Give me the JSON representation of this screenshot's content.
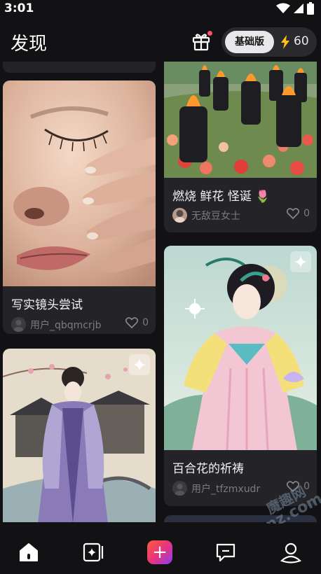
{
  "status_bar": {
    "time": "3:01"
  },
  "header": {
    "title": "发现",
    "plan_label": "基础版",
    "credits": "60"
  },
  "cards": [
    {
      "title": "写实镜头尝试",
      "author": "用户_qbqmcrjb",
      "likes": "0"
    },
    {
      "title": "燃烧 鲜花 怪诞 🌷",
      "author": "无敌豆女士",
      "likes": "0"
    },
    {
      "title": "百合花的祈祷",
      "author": "用户_tfzmxudr",
      "likes": "0"
    },
    {
      "title": "",
      "author": "",
      "likes": ""
    }
  ],
  "bottom_nav": {
    "items": [
      {
        "icon": "home-icon"
      },
      {
        "icon": "gallery-icon"
      },
      {
        "icon": "create-plus-icon",
        "label": "+"
      },
      {
        "icon": "message-icon"
      },
      {
        "icon": "profile-icon"
      }
    ]
  },
  "watermark": {
    "cn": "魔趣网",
    "en": "mfunz.com"
  },
  "colors": {
    "accent_gradient": [
      "#ff5a3c",
      "#e8357a",
      "#8e3cf5"
    ],
    "background": "#121214",
    "card": "#242428"
  }
}
